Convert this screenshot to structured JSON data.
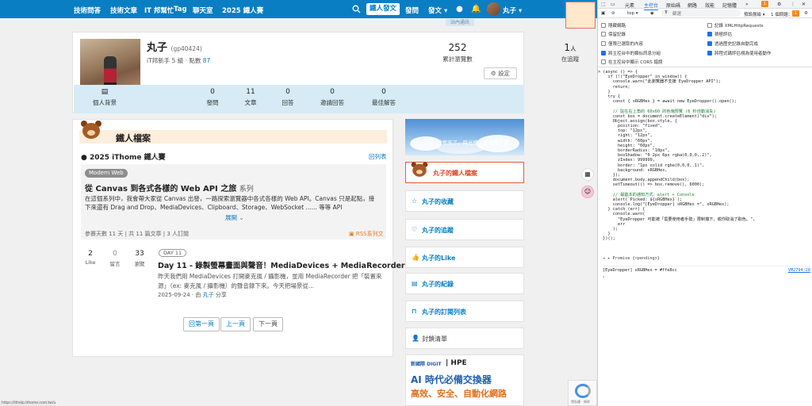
{
  "nav": {
    "items": [
      "技術問答",
      "技術文章",
      "IT 邦幫忙",
      "Tag",
      "聊天室",
      "2025 鐵人賽"
    ],
    "post_button": "鐵人發文",
    "ask": "發問",
    "write": "發文",
    "user": "丸子",
    "station_tag": "站內通訊"
  },
  "profile": {
    "name": "丸子",
    "handle": "(gp40424)",
    "rank_text": "iT邦新手 5 級 · 點數",
    "points": "87",
    "views": "252",
    "views_label": "累計瀏覽數",
    "following": "1",
    "following_unit": "人",
    "following_label": "在追蹤",
    "settings": "設定",
    "stats": [
      {
        "value": "",
        "label": "個人背景"
      },
      {
        "value": "0",
        "label": "發問"
      },
      {
        "value": "11",
        "label": "文章"
      },
      {
        "value": "0",
        "label": "回答"
      },
      {
        "value": "0",
        "label": "邀請回答"
      },
      {
        "value": "0",
        "label": "最佳解答"
      }
    ]
  },
  "section": {
    "title": "鐵人檔案",
    "ithome_title": "2025 iThome 鐵人賽",
    "series_list": "回列表",
    "tag": "Modern Web",
    "series_title": "從 Canvas 到各式各樣的 Web API 之旅",
    "series_suffix": "系列",
    "series_desc": "在這個系列中，我會帶大家從 Canvas 出發，一路探索瀏覽器中各式各樣的 Web API。Canvas 只是起點，接下來還有 Drag and Drop、MediaDevices、Clipboard、Storage、WebSocket ...... 等等 API",
    "expand": "展開",
    "series_foot": "參賽天數 11 天 | 共 11 篇文章 | 3 人訂閱",
    "rss": "RSS系列文"
  },
  "article": {
    "likes": "2",
    "likes_label": "Like",
    "comments": "0",
    "comments_label": "留言",
    "views": "33",
    "views_label": "瀏覽",
    "day": "DAY 11",
    "title": "Day 11 - 錄製螢幕畫面與聲音！MediaDevices + MediaRecorder",
    "desc": "昨天我們用 MediaDevices 打開麥克風 / 攝影機，並用 MediaRecorder 把「裝置來源」（ex: 麥克風 / 攝影機）的聲音錄下來。今天把場景從...",
    "date": "2025-09-24",
    "by": "· 由",
    "author": "丸子",
    "share": "分享"
  },
  "pager": {
    "first": "回第一頁",
    "prev": "上一頁",
    "next": "下一頁"
  },
  "sidebar": {
    "banner_text": "我要來了，時光機 · 前往鐵人賽",
    "profile": "丸子的鐵人檔案",
    "items": [
      {
        "icon": "☆",
        "label": "丸子的收藏"
      },
      {
        "icon": "♡",
        "label": "丸子的追蹤"
      },
      {
        "icon": "👍",
        "label": "丸子的Like"
      },
      {
        "icon": "▤",
        "label": "丸子的紀錄"
      },
      {
        "icon": "⊓",
        "label": "丸子的訂閱列表"
      }
    ],
    "blocked": "封鎖清單"
  },
  "ad": {
    "brand1": "新國際 DIGIT",
    "brand2": "| HPE",
    "headline": "AI 時代必備交換器",
    "tagline": "高效、安全、自動化網路"
  },
  "recaptcha": "隱私權 - 條款",
  "status_url": "https://ithelp.ithome.com.tw/users/gp40424/ironman",
  "devtools": {
    "tabs": [
      "元素",
      "主控台",
      "原始碼",
      "網路",
      "效能",
      "記憶體"
    ],
    "active_tab": "主控台",
    "warn_count": "1",
    "top": "top",
    "filter": "篩選",
    "levels": "預設層級",
    "issues": "1 個問題：",
    "issues_count": "1",
    "settings_left": [
      "隱藏網路",
      "保留記錄",
      "僅限已選取的內容",
      "將主控台中的類似訊息分組",
      "在主控台中顯示 CORS 錯誤"
    ],
    "settings_left_checked": [
      false,
      false,
      false,
      true,
      false
    ],
    "settings_right": [
      "記錄 XMLHttpRequests",
      "積極評估",
      "透過歷史記錄自動完成",
      "將程式碼評估視為使用者動作"
    ],
    "settings_right_checked": [
      false,
      true,
      true,
      true
    ],
    "code_lines": [
      "> (async () => {",
      "    if (!(\"EyeDropper\" in window)) {",
      "      console.warn(\"此瀏覽器不支援 EyeDropper API\");",
      "      return;",
      "    }",
      "    try {",
      "      const { sRGBHex } = await new EyeDropper().open();",
      "",
      "      // 貼在右上角的 60x60 的色塊預覽 (6 秒自動消失)",
      "      const box = document.createElement(\"div\");",
      "      Object.assign(box.style, {",
      "        position: \"fixed\",",
      "        top: \"12px\",",
      "        right: \"12px\",",
      "        width: \"60px\",",
      "        height: \"60px\",",
      "        borderRadius: \"10px\",",
      "        boxShadow: \"0 2px 6px rgba(0,0,0,.2)\",",
      "        zIndex: 999999,",
      "        border: \"1px solid rgba(0,0,0,.1)\",",
      "        background: sRGBHex,",
      "      });",
      "      document.body.appendChild(box);",
      "      setTimeout(() => box.remove(), 6000);",
      "",
      "      // 最基本的通知方式：alert + Console",
      "      alert(`Picked: ${sRGBHex}`);",
      "      console.log(\"[EyeDropper] sRGBHex =\", sRGBHex);",
      "    } catch (err) {",
      "      console.warn(",
      "        \"EyeDropper 可能被「需要使用者手勢」限制擋下，或你取消了取色。\",",
      "        err",
      "      );",
      "    }",
      "  })();"
    ],
    "promise": "◂ ▸ Promise {<pending>}",
    "log": "[EyeDropper] sRGBHex = #ffe8cc",
    "log_src": "VM2794:28",
    "picked_color": "#ffe8cc"
  }
}
